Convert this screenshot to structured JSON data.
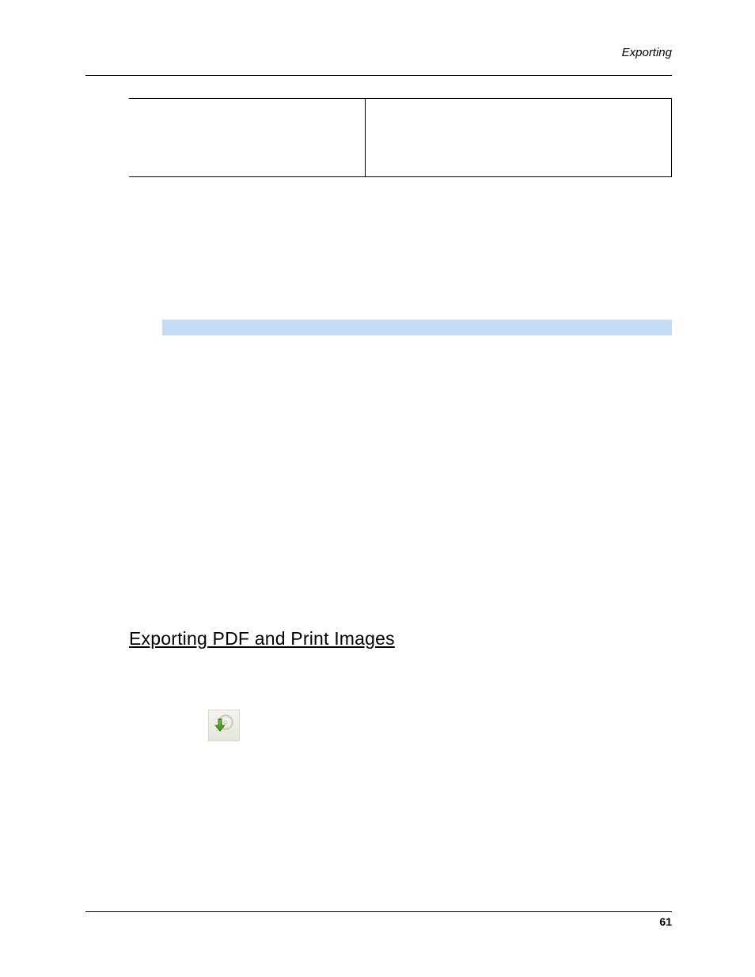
{
  "header": {
    "section": "Exporting"
  },
  "section_heading": "Exporting PDF and Print Images",
  "icon": {
    "name": "download-disc-icon"
  },
  "footer": {
    "page_number": "61"
  }
}
